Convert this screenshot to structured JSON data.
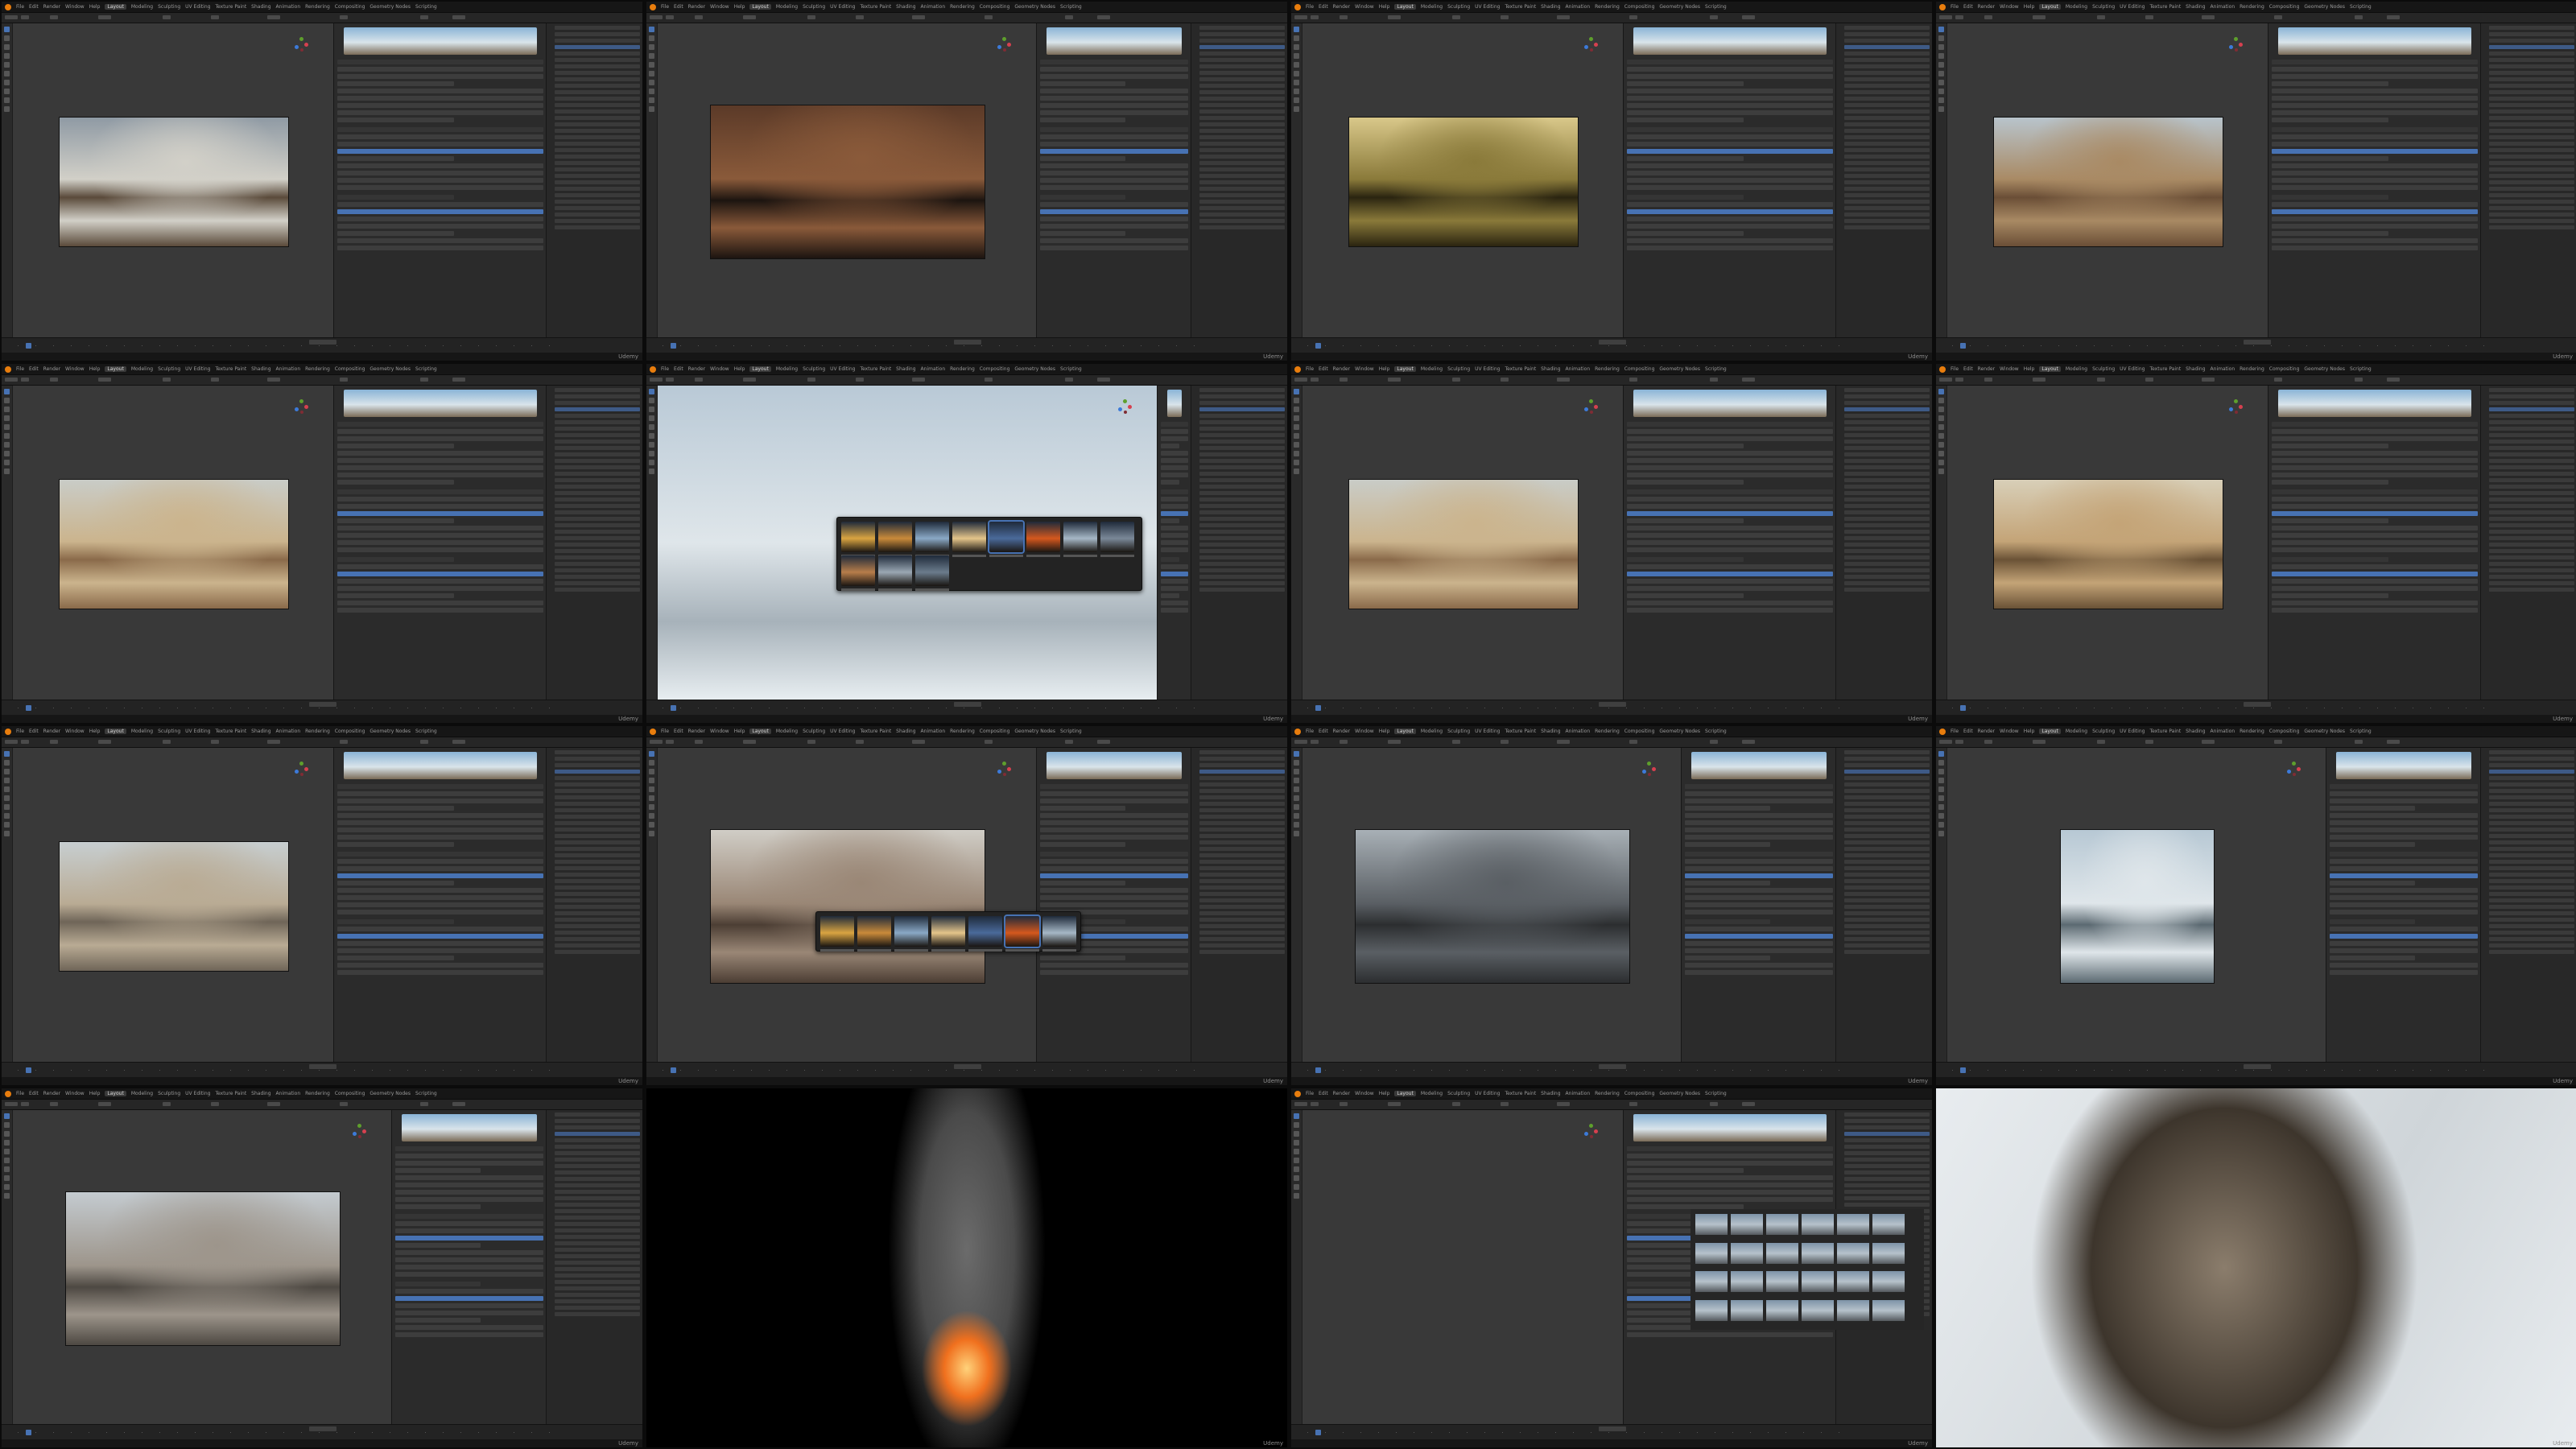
{
  "contact_sheet": {
    "rows": 4,
    "columns": 4,
    "background": "#0b0b0b"
  },
  "blender": {
    "menu": [
      "File",
      "Edit",
      "Render",
      "Window",
      "Help"
    ],
    "workspaces": [
      "Layout",
      "Modeling",
      "Sculpting",
      "UV Editing",
      "Texture Paint",
      "Shading",
      "Animation",
      "Rendering",
      "Compositing",
      "Geometry Nodes",
      "Scripting"
    ],
    "active_workspace": "Layout",
    "theme": {
      "background": "#1d1d1d",
      "viewport": "#393939",
      "panel": "#2b2b2b",
      "accent": "#4772b3",
      "logo": "#e87d0d"
    }
  },
  "watermark": "Udemy",
  "frames": [
    {
      "id": 1,
      "type": "blender",
      "scene": "misty-lake-canyon",
      "render_colors": [
        "#8f9aa4",
        "#d2d0c8",
        "#5a4a3a"
      ]
    },
    {
      "id": 2,
      "type": "blender",
      "scene": "dusk-canyon-dark",
      "render_colors": [
        "#5b3a28",
        "#8a5a3a",
        "#1c1410"
      ]
    },
    {
      "id": 3,
      "type": "blender",
      "scene": "golden-hour-canyon",
      "render_colors": [
        "#d9c88a",
        "#8a7a3a",
        "#2a2410"
      ]
    },
    {
      "id": 4,
      "type": "blender",
      "scene": "daylight-canyon",
      "render_colors": [
        "#b8c4cc",
        "#a98a64",
        "#6a4e36"
      ]
    },
    {
      "id": 5,
      "type": "blender",
      "scene": "sandy-canyon",
      "render_colors": [
        "#c9ccc7",
        "#cbb48d",
        "#8a6a4a"
      ]
    },
    {
      "id": 6,
      "type": "blender-hdri-picker",
      "scene": "snow-terrain",
      "render_colors": [
        "#aebfcc",
        "#e6ecf0",
        "#8a98a4"
      ]
    },
    {
      "id": 7,
      "type": "blender",
      "scene": "sandy-canyon",
      "render_colors": [
        "#c9ccc7",
        "#cbb48d",
        "#8a6a4a"
      ]
    },
    {
      "id": 8,
      "type": "blender",
      "scene": "sandy-canyon-warm",
      "render_colors": [
        "#d8cfb8",
        "#c4a477",
        "#6a5236"
      ]
    },
    {
      "id": 9,
      "type": "blender",
      "scene": "misty-canyon",
      "render_colors": [
        "#c7ced0",
        "#b9ab94",
        "#6f6558"
      ]
    },
    {
      "id": 10,
      "type": "blender-hdri-picker",
      "scene": "overcast-canyon",
      "render_colors": [
        "#d0cdc6",
        "#9a8776",
        "#4c3e34"
      ]
    },
    {
      "id": 11,
      "type": "blender",
      "scene": "stormy-rocks",
      "render_colors": [
        "#a8b0b6",
        "#5a5f64",
        "#2c2e30"
      ]
    },
    {
      "id": 12,
      "type": "blender",
      "scene": "fog-canyon-ship",
      "render_colors": [
        "#b7c8d4",
        "#dfe6ea",
        "#5c6a72"
      ]
    },
    {
      "id": 13,
      "type": "blender",
      "scene": "foggy-canyon-wide",
      "render_colors": [
        "#c4cbd0",
        "#9d958b",
        "#4d4842"
      ]
    },
    {
      "id": 14,
      "type": "render",
      "scene": "fire-smoke-plume",
      "render_colors": [
        "#000000",
        "#4a4a4a",
        "#f0701e"
      ]
    },
    {
      "id": 15,
      "type": "blender-asset-browser",
      "scene": "empty-viewport",
      "render_colors": [
        "#333333",
        "#3a3a3a",
        "#5a6a7a"
      ]
    },
    {
      "id": 16,
      "type": "render",
      "scene": "tornado-closeup",
      "render_colors": [
        "#e8ecef",
        "#8b7d6c",
        "#3d352c"
      ]
    }
  ]
}
